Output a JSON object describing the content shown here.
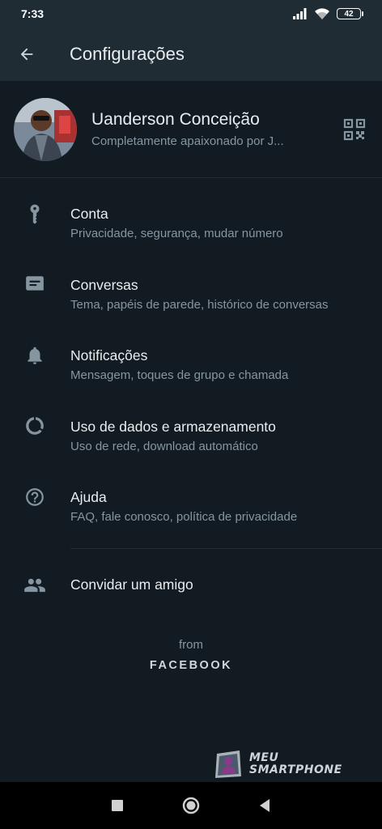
{
  "status_bar": {
    "time": "7:33",
    "battery": "42",
    "icons": [
      "signal-icon",
      "wifi-icon",
      "battery-icon"
    ]
  },
  "app_bar": {
    "title": "Configurações",
    "back_icon": "arrow-back-icon"
  },
  "profile": {
    "name": "Uanderson Conceição",
    "about": "Completamente apaixonado por J...",
    "qr_icon": "qr-code-icon"
  },
  "menu": [
    {
      "icon": "key-icon",
      "title": "Conta",
      "subtitle": "Privacidade, segurança, mudar número"
    },
    {
      "icon": "chat-icon",
      "title": "Conversas",
      "subtitle": "Tema, papéis de parede, histórico de conversas"
    },
    {
      "icon": "bell-icon",
      "title": "Notificações",
      "subtitle": "Mensagem, toques de grupo e chamada"
    },
    {
      "icon": "data-usage-icon",
      "title": "Uso de dados e armazenamento",
      "subtitle": "Uso de rede, download automático"
    },
    {
      "icon": "help-icon",
      "title": "Ajuda",
      "subtitle": "FAQ, fale conosco, política de privacidade"
    }
  ],
  "invite": {
    "icon": "people-icon",
    "title": "Convidar um amigo"
  },
  "footer": {
    "from": "from",
    "brand": "FACEBOOK"
  },
  "watermark": {
    "line1": "MEU",
    "line2": "SMARTPHONE"
  },
  "nav": {
    "icons": [
      "recents-icon",
      "home-icon",
      "back-icon"
    ]
  },
  "colors": {
    "background": "#121b22",
    "app_bar": "#1f2c34",
    "text": "#e9edef",
    "secondary": "#8696a0",
    "icon": "#8696a0"
  }
}
